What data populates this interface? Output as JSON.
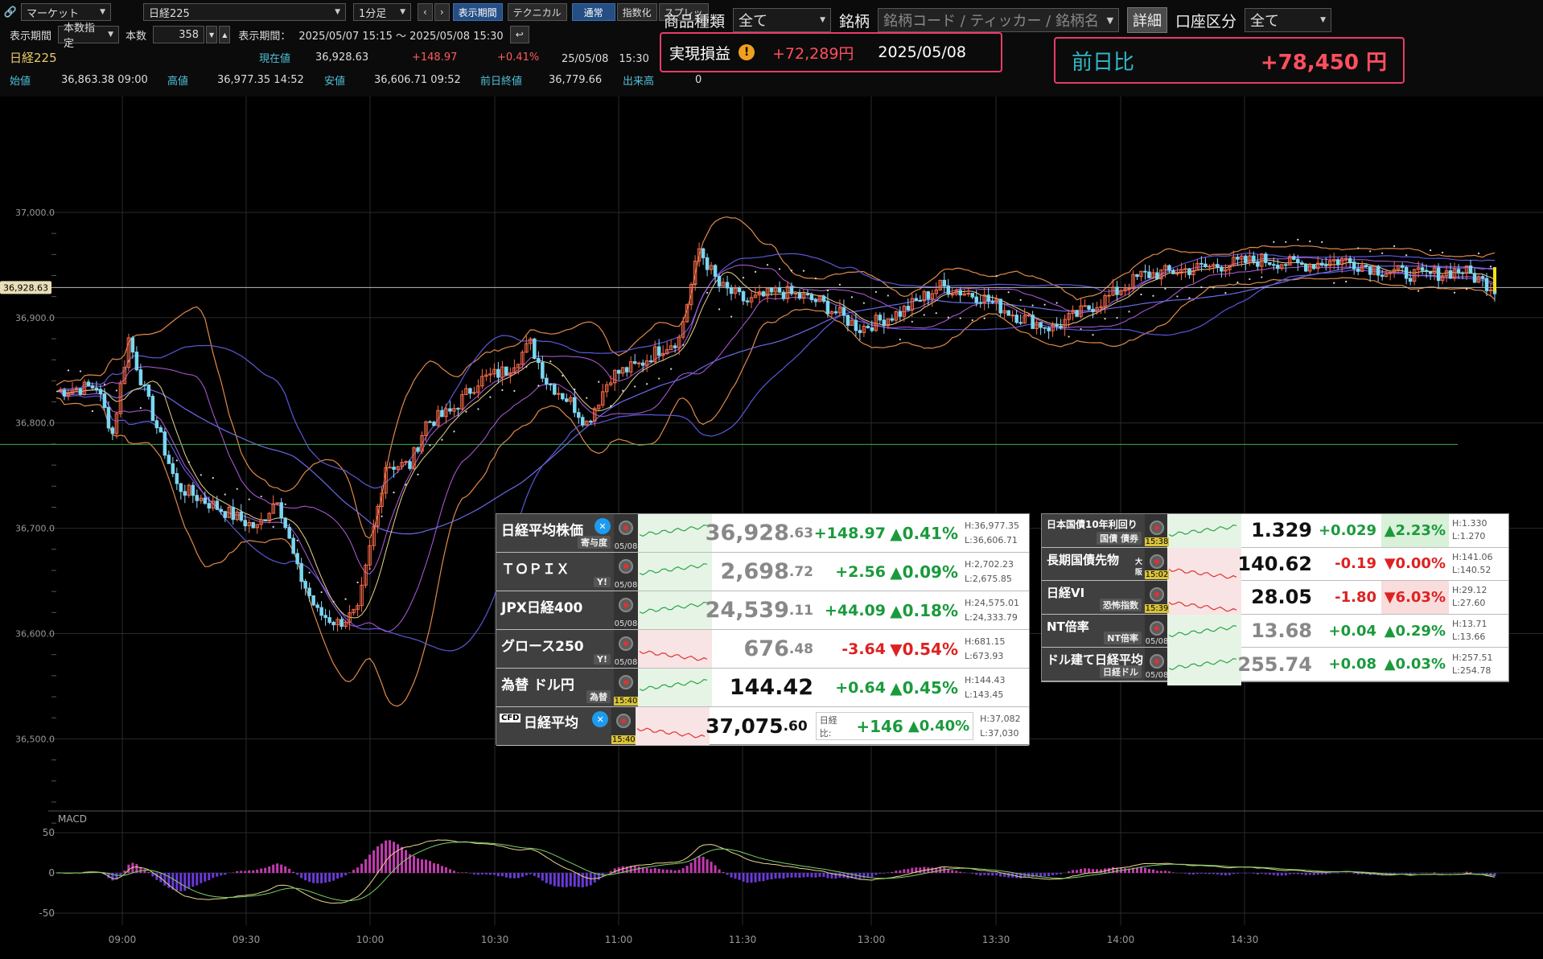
{
  "toolbar": {
    "row1": {
      "source": "マーケット",
      "symbol": "日経225",
      "interval": "1分足",
      "btn_period": "表示期間",
      "btn_technical": "テクニカル",
      "btn_normal": "通常",
      "btn_index": "指数化",
      "btn_spread": "スプレッ"
    },
    "row2": {
      "period_label": "表示期間",
      "period_mode": "本数指定",
      "count_label": "本数",
      "count_value": "358",
      "range_label": "表示期間：",
      "range_value": "2025/05/07 15:15 ～ 2025/05/08 15:30"
    },
    "row3": {
      "name": "日経225",
      "current_label": "現在値",
      "current_value": "36,928.63",
      "change": "+148.97",
      "change_pct": "+0.41%",
      "time": "25/05/08　15:30"
    },
    "row4": {
      "open_label": "始値",
      "open_value": "36,863.38 09:00",
      "high_label": "高値",
      "high_value": "36,977.35 14:52",
      "low_label": "安値",
      "low_value": "36,606.71 09:52",
      "prev_label": "前日終値",
      "prev_value": "36,779.66",
      "volume_label": "出来高",
      "volume_value": "0"
    }
  },
  "filter": {
    "product_label": "商品種類",
    "product_value": "全て",
    "brand_label": "銘柄",
    "search_placeholder": "銘柄コード / ティッカー / 銘柄名",
    "detail_button": "詳細",
    "account_label": "口座区分",
    "account_value": "全て"
  },
  "pnl": {
    "realized_label": "実現損益",
    "realized_value": "+72,289円",
    "realized_date": "2025/05/08",
    "prev_label": "前日比",
    "prev_value": "+78,450 円"
  },
  "chart_data": {
    "type": "candlestick",
    "price_axis": {
      "ticks": [
        "37,000.0",
        "36,900.0",
        "36,800.0",
        "36,700.0",
        "36,600.0",
        "36,500.0"
      ],
      "ylim": [
        36430,
        37110
      ]
    },
    "current_price_label": "36,928.63",
    "prev_close": 36779.66,
    "time_axis": [
      "09:00",
      "09:30",
      "10:00",
      "10:30",
      "11:00",
      "11:30",
      "13:00",
      "13:30",
      "14:00",
      "14:30"
    ],
    "price_path": [
      [
        0,
        36830
      ],
      [
        10,
        36835
      ],
      [
        14,
        36790
      ],
      [
        18,
        36880
      ],
      [
        22,
        36830
      ],
      [
        30,
        36740
      ],
      [
        40,
        36720
      ],
      [
        50,
        36700
      ],
      [
        55,
        36730
      ],
      [
        60,
        36660
      ],
      [
        65,
        36620
      ],
      [
        70,
        36610
      ],
      [
        75,
        36620
      ],
      [
        82,
        36760
      ],
      [
        88,
        36760
      ],
      [
        92,
        36800
      ],
      [
        98,
        36810
      ],
      [
        105,
        36840
      ],
      [
        112,
        36850
      ],
      [
        118,
        36875
      ],
      [
        122,
        36840
      ],
      [
        128,
        36820
      ],
      [
        132,
        36800
      ],
      [
        138,
        36845
      ],
      [
        145,
        36855
      ],
      [
        150,
        36870
      ],
      [
        155,
        36880
      ],
      [
        160,
        36965
      ],
      [
        165,
        36930
      ],
      [
        172,
        36915
      ],
      [
        180,
        36925
      ],
      [
        190,
        36915
      ],
      [
        200,
        36890
      ],
      [
        210,
        36905
      ],
      [
        220,
        36930
      ],
      [
        230,
        36920
      ],
      [
        240,
        36900
      ],
      [
        248,
        36890
      ],
      [
        255,
        36905
      ],
      [
        262,
        36920
      ],
      [
        270,
        36940
      ],
      [
        280,
        36945
      ],
      [
        290,
        36950
      ],
      [
        300,
        36955
      ],
      [
        310,
        36950
      ],
      [
        320,
        36955
      ],
      [
        330,
        36945
      ],
      [
        340,
        36940
      ],
      [
        350,
        36945
      ],
      [
        358,
        36928
      ]
    ],
    "macd": {
      "label": "MACD",
      "ticks": [
        "50",
        "0",
        "-50"
      ],
      "ylim": [
        -65,
        65
      ]
    }
  },
  "quotes_left": [
    {
      "name": "日経平均株価",
      "sub": "寄与度",
      "date": "05/08",
      "x_badge": true,
      "value_int": "36,928",
      "value_dec": ".63",
      "value_gray": true,
      "change": "+148.97",
      "pct": "▲0.41%",
      "dir": "up",
      "high": "H:36,977.35",
      "low": "L:36,606.71"
    },
    {
      "name": "ＴＯＰＩＸ",
      "sub": "Y!",
      "date": "05/08",
      "value_int": "2,698",
      "value_dec": ".72",
      "value_gray": true,
      "change": "+2.56",
      "pct": "▲0.09%",
      "dir": "up",
      "high": "H:2,702.23",
      "low": "L:2,675.85"
    },
    {
      "name": "JPX日経400",
      "sub": "",
      "date": "05/08",
      "value_int": "24,539",
      "value_dec": ".11",
      "value_gray": true,
      "change": "+44.09",
      "pct": "▲0.18%",
      "dir": "up",
      "high": "H:24,575.01",
      "low": "L:24,333.79"
    },
    {
      "name": "グロース250",
      "sub": "Y!",
      "date": "05/08",
      "value_int": "676",
      "value_dec": ".48",
      "value_gray": true,
      "change": "-3.64",
      "pct": "▼0.54%",
      "dir": "dn",
      "high": "H:681.15",
      "low": "L:673.93"
    },
    {
      "name": "為替 ドル円",
      "sub": "為替",
      "date": "15:40",
      "date_hl": true,
      "value_int": "144.42",
      "value_dec": "",
      "value_gray": false,
      "change": "+0.64",
      "pct": "▲0.45%",
      "dir": "up",
      "high": "H:144.43",
      "low": "L:143.45"
    }
  ],
  "cfd": {
    "badge": "CFD",
    "name": "日経平均",
    "date": "15:40",
    "value_int": "37,075",
    "value_dec": ".60",
    "diff_label": "日経比:",
    "diff_value": "+146",
    "pct": "▲0.40%",
    "high": "H:37,082",
    "low": "L:37,030"
  },
  "quotes_right": [
    {
      "name": "日本国債10年利回り",
      "sub": "国債 債券",
      "date": "15:38",
      "date_hl": true,
      "value": "1.329",
      "change": "+0.029",
      "pct": "▲2.23%",
      "dir": "up",
      "pct_bg": true,
      "high": "H:1.330",
      "low": "L:1.270"
    },
    {
      "name": "長期国債先物",
      "name_suffix": "大阪",
      "sub": "",
      "date": "15:02",
      "date_hl": true,
      "value": "140.62",
      "change": "-0.19",
      "pct": "▼0.00%",
      "dir": "dn",
      "high": "H:141.06",
      "low": "L:140.52"
    },
    {
      "name": "日経VI",
      "sub": "恐怖指数",
      "date": "15:39",
      "date_hl": true,
      "value": "28.05",
      "change": "-1.80",
      "pct": "▼6.03%",
      "dir": "dn",
      "pct_bg": true,
      "high": "H:29.12",
      "low": "L:27.60"
    },
    {
      "name": "NT倍率",
      "sub": "NT倍率",
      "date": "05/08",
      "value": "13.68",
      "change": "+0.04",
      "pct": "▲0.29%",
      "dir": "up",
      "value_gray": true,
      "high": "H:13.71",
      "low": "L:13.66"
    },
    {
      "name": "ドル建て日経平均",
      "sub": "日経ドル",
      "date": "05/08",
      "value": "255.74",
      "change": "+0.08",
      "pct": "▲0.03%",
      "dir": "up",
      "value_gray": true,
      "high": "H:257.51",
      "low": "L:254.78"
    }
  ]
}
